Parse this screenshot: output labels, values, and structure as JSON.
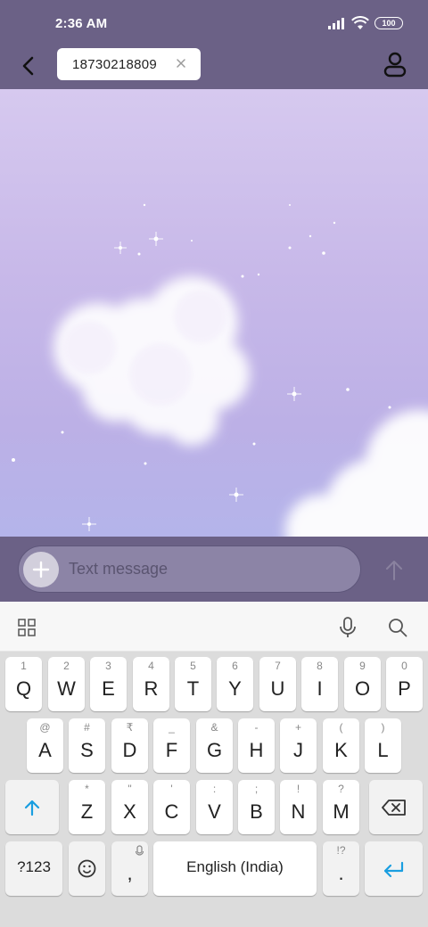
{
  "status_bar": {
    "time": "2:36 AM",
    "battery": "100",
    "icons": [
      "signal-icon",
      "wifi-icon",
      "battery-icon"
    ]
  },
  "header": {
    "recipient": "18730218809",
    "icons": [
      "back-arrow-icon",
      "close-icon",
      "contact-icon"
    ]
  },
  "composer": {
    "placeholder": "Text message",
    "icons": [
      "plus-icon",
      "send-arrow-icon"
    ]
  },
  "keyboard": {
    "toolbar_icons": [
      "apps-grid-icon",
      "microphone-icon",
      "search-icon"
    ],
    "row1": [
      {
        "key": "Q",
        "hint": "1"
      },
      {
        "key": "W",
        "hint": "2"
      },
      {
        "key": "E",
        "hint": "3"
      },
      {
        "key": "R",
        "hint": "4"
      },
      {
        "key": "T",
        "hint": "5"
      },
      {
        "key": "Y",
        "hint": "6"
      },
      {
        "key": "U",
        "hint": "7"
      },
      {
        "key": "I",
        "hint": "8"
      },
      {
        "key": "O",
        "hint": "9"
      },
      {
        "key": "P",
        "hint": "0"
      }
    ],
    "row2": [
      {
        "key": "A",
        "hint": "@"
      },
      {
        "key": "S",
        "hint": "#"
      },
      {
        "key": "D",
        "hint": "₹"
      },
      {
        "key": "F",
        "hint": "_"
      },
      {
        "key": "G",
        "hint": "&"
      },
      {
        "key": "H",
        "hint": "-"
      },
      {
        "key": "J",
        "hint": "+"
      },
      {
        "key": "K",
        "hint": "("
      },
      {
        "key": "L",
        "hint": ")"
      }
    ],
    "row3": [
      {
        "key": "Z",
        "hint": "*"
      },
      {
        "key": "X",
        "hint": "\""
      },
      {
        "key": "C",
        "hint": "'"
      },
      {
        "key": "V",
        "hint": ":"
      },
      {
        "key": "B",
        "hint": ";"
      },
      {
        "key": "N",
        "hint": "!"
      },
      {
        "key": "M",
        "hint": "?"
      }
    ],
    "symbols_label": "?123",
    "comma": ",",
    "space_label": "English (India)",
    "period": ".",
    "period_hint": "!?",
    "special_icons": [
      "shift-arrow-icon",
      "backspace-icon",
      "emoji-icon",
      "enter-icon"
    ],
    "accent_color": "#1a9ee0"
  },
  "colors": {
    "bar": "#6b6186",
    "keyboard_bg": "#dcdcdc"
  }
}
